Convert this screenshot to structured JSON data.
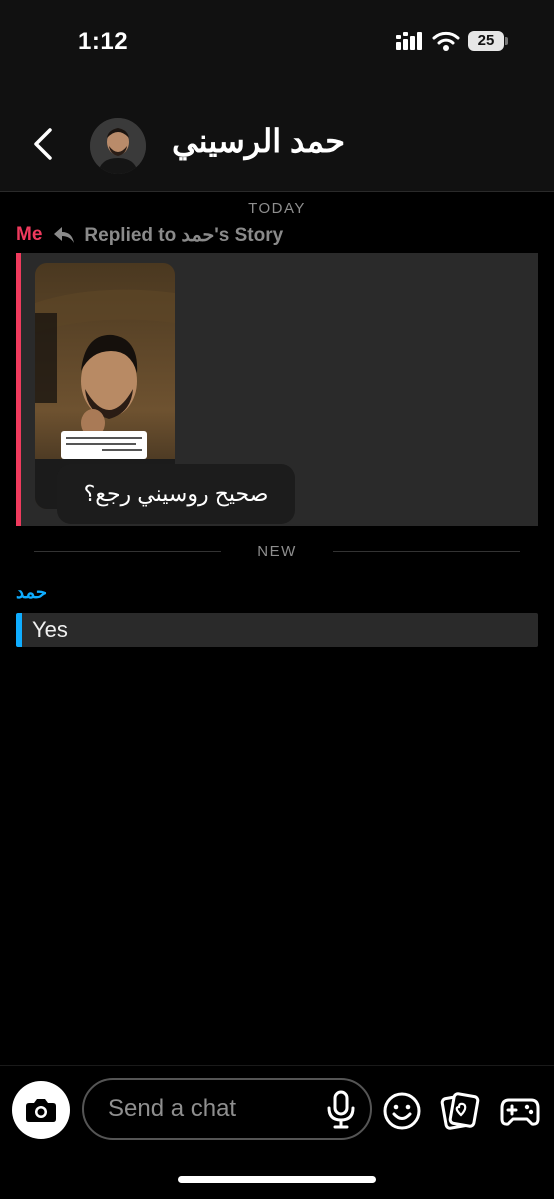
{
  "status_bar": {
    "time": "1:12",
    "battery": "25"
  },
  "header": {
    "contact_name": "حمد الرسيني"
  },
  "conversation": {
    "day_label": "TODAY",
    "reply_line": {
      "me_label": "Me",
      "replied_text": "Replied to حمد's Story"
    },
    "story_reply_text": "صحيح روسيني رجع؟",
    "new_divider_label": "NEW",
    "messages": [
      {
        "sender": "حمد",
        "text": "Yes"
      }
    ]
  },
  "composer": {
    "placeholder": "Send a chat"
  },
  "colors": {
    "me_accent": "#ef3a5d",
    "friend_accent": "#0fadff",
    "bubble_bg": "#2a2a2a"
  },
  "icons": {
    "back": "chevron-left-icon",
    "reply": "reply-arrow-icon",
    "camera": "camera-icon",
    "mic": "microphone-icon",
    "emoji": "smiley-icon",
    "memories": "memories-icon",
    "games": "gamepad-icon"
  }
}
